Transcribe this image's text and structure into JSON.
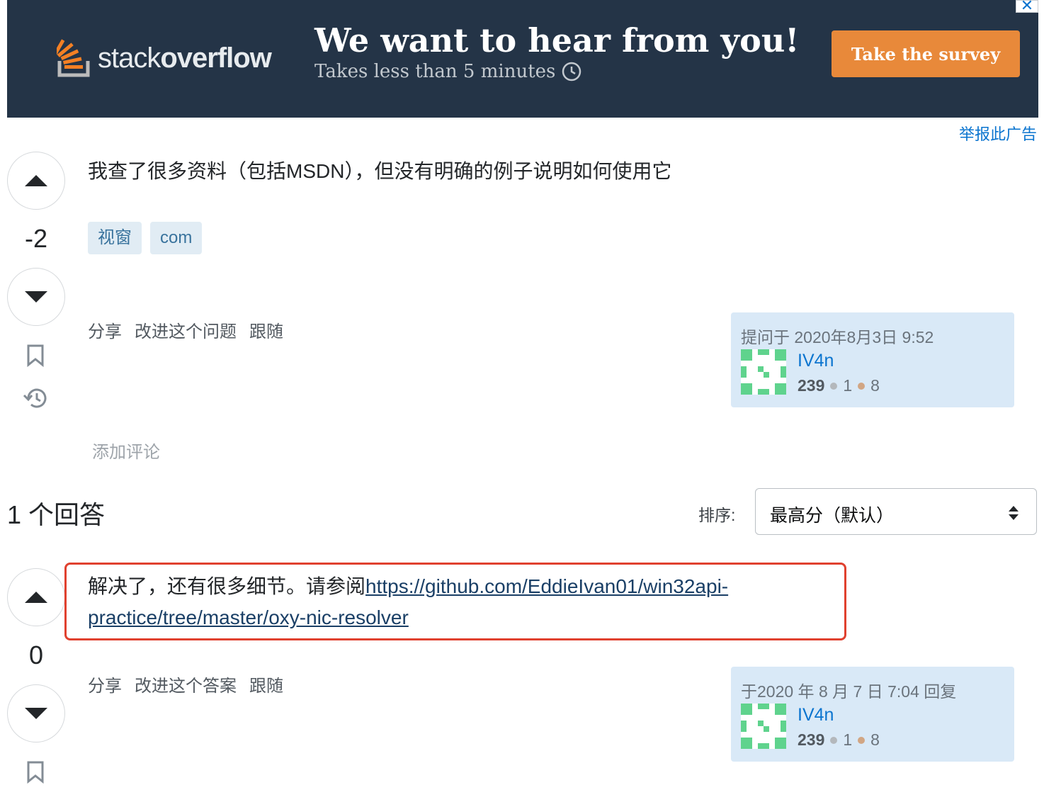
{
  "ad": {
    "logo_text_light": "stack",
    "logo_text_bold": "overflow",
    "headline": "We want to hear from you!",
    "subline": "Takes less than 5 minutes",
    "cta": "Take the survey",
    "close_glyph": "✕",
    "report": "举报此广告"
  },
  "question": {
    "score": "-2",
    "body": "我查了很多资料（包括MSDN），但没有明确的例子说明如何使用它",
    "tags": [
      "视窗",
      "com"
    ],
    "menu": [
      "分享",
      "改进这个问题",
      "跟随"
    ],
    "asked": "提问于 2020年8月3日 9:52",
    "user": {
      "name": "IV4n",
      "rep": "239",
      "silver": "1",
      "bronze": "8"
    },
    "add_comment": "添加评论"
  },
  "answers": {
    "title": "1 个回答",
    "sort_label": "排序:",
    "sort_value": "最高分（默认）"
  },
  "answer": {
    "score": "0",
    "text": "解决了，还有很多细节。请参阅",
    "link": "https://github.com/EddieIvan01/win32api-practice/tree/master/oxy-nic-resolver",
    "menu": [
      "分享",
      "改进这个答案",
      "跟随"
    ],
    "answered": "于2020 年 8 月 7 日 7:04 回复",
    "user": {
      "name": "IV4n",
      "rep": "239",
      "silver": "1",
      "bronze": "8"
    }
  },
  "colors": {
    "banner": "#243447",
    "cta": "#e8893a",
    "link": "#0a74cf",
    "tag_bg": "#e1ecf4",
    "user_card": "#d9e9f7",
    "highlight": "#e0412f"
  },
  "icons": [
    "stackoverflow-logo-icon",
    "clock-icon",
    "close-icon",
    "upvote-icon",
    "downvote-icon",
    "bookmark-icon",
    "history-icon",
    "identicon-avatar",
    "sort-arrows-icon"
  ]
}
